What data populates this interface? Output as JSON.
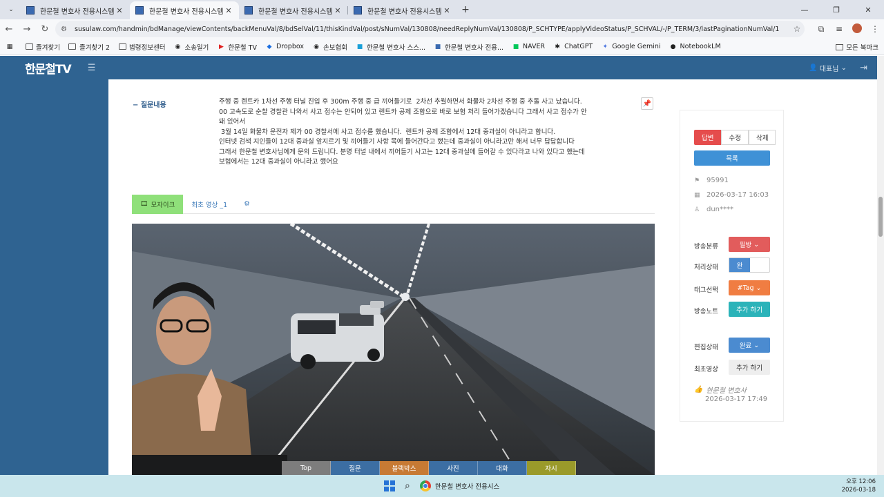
{
  "browser": {
    "tabs": [
      {
        "label": "한문철 변호사 전용시스템",
        "active": false
      },
      {
        "label": "한문철 변호사 전용시스템",
        "active": true
      },
      {
        "label": "한문철 변호사 전용시스템",
        "active": false
      },
      {
        "label": "한문철 변호사 전용시스템",
        "active": false
      }
    ],
    "url": "susulaw.com/handmin/bdManage/viewContents/backMenuVal/8/bdSelVal/11/thisKindVal/post/sNumVal/130808/needReplyNumVal/130808/P_SCHTYPE/applyVideoStatus/P_SCHVAL/-/P_TERM/3/lastPaginationNumVal/1",
    "bookmarks": [
      {
        "label": "즐겨찾기",
        "icon": "folder-icon"
      },
      {
        "label": "즐겨찾기 2",
        "icon": "folder-icon"
      },
      {
        "label": "법령정보센터",
        "icon": "folder-icon"
      },
      {
        "label": "소송일기",
        "icon": "globe-icon"
      },
      {
        "label": "한문철 TV",
        "icon": "youtube-icon"
      },
      {
        "label": "Dropbox",
        "icon": "dropbox-icon"
      },
      {
        "label": "손보협회",
        "icon": "globe-icon"
      },
      {
        "label": "한문철 변호사 스스...",
        "icon": "site-icon"
      },
      {
        "label": "한문철 변호사 전용...",
        "icon": "site-icon"
      },
      {
        "label": "NAVER",
        "icon": "naver-icon"
      },
      {
        "label": "ChatGPT",
        "icon": "chatgpt-icon"
      },
      {
        "label": "Google Gemini",
        "icon": "gemini-icon"
      },
      {
        "label": "NotebookLM",
        "icon": "notebooklm-icon"
      }
    ],
    "all_bookmarks": "모든 북마크"
  },
  "header": {
    "logo": "한문철TV",
    "user": "대표님"
  },
  "question": {
    "label": "질문내용",
    "lines": [
      "주행 중 렌트카 1차선 주행 터널 진입 후 300m 주행 중 급 끼어들기로  2차선 추월하면서 화물차 2차선 주행 중 추돌 사고 났습니다.",
      "00 고속도로 순찰 경찰관 나와서 사고 접수는 안되어 있고 렌트카 공제 조합으로 바로 보험 처리 들어가겠습니다 그래서 사고 접수가 안 돼 있어서",
      " 3월 14일 화물차 운전자 제가 00 경찰서에 사고 접수를 했습니다.  렌트카 공제 조합에서 12대 중과실이 아니라고 합니다.",
      "인터넷 검색 지인들이 12대 중과실 앞지르기 및 끼어들기 사항 목에 들어간다고 했는데 중과실이 아니라고만 해서 너무 답답합니다",
      "그래서 한문철 변호사님에게 문의 드립니다. 분명 터널 내에서 끼어들기 사고는 12대 중과실에 들어갈 수 있다라고 나와 있다고 했는데",
      "보험에서는 12대 중과실이 아니라고 했어요"
    ]
  },
  "content_tabs": {
    "mosaic": "모자이크",
    "first_video": "최초 영상 _1"
  },
  "side": {
    "buttons": {
      "reply": "답변",
      "edit": "수정",
      "delete": "삭제",
      "list": "목록"
    },
    "meta": {
      "id": "95991",
      "date": "2026-03-17 16:03",
      "user": "dun****"
    },
    "fields": {
      "broadcast_category": {
        "label": "방송분류",
        "value": "필방"
      },
      "process_status": {
        "label": "처리상태",
        "value": "완"
      },
      "tag_select": {
        "label": "태그선택",
        "value": "#Tag"
      },
      "broadcast_note": {
        "label": "방송노트",
        "value": "추가 하기"
      },
      "edit_status": {
        "label": "편집상태",
        "value": "완료"
      },
      "first_video": {
        "label": "최초영상",
        "value": "추가 하기"
      }
    },
    "author": {
      "name": "한문철 변호사",
      "date": "2026-03-17 17:49"
    }
  },
  "category_bar": [
    {
      "label": "Top",
      "color": "#7d7d7d"
    },
    {
      "label": "질문",
      "color": "#3c6ea3"
    },
    {
      "label": "블랙박스",
      "color": "#c77a34"
    },
    {
      "label": "사진",
      "color": "#3c6ea3"
    },
    {
      "label": "대화",
      "color": "#3c6ea3"
    },
    {
      "label": "자시",
      "color": "#9a9a2a"
    }
  ],
  "taskbar": {
    "app_label": "한문철 변호사 전용시스",
    "time": "오후 12:06",
    "date": "2026-03-18"
  }
}
